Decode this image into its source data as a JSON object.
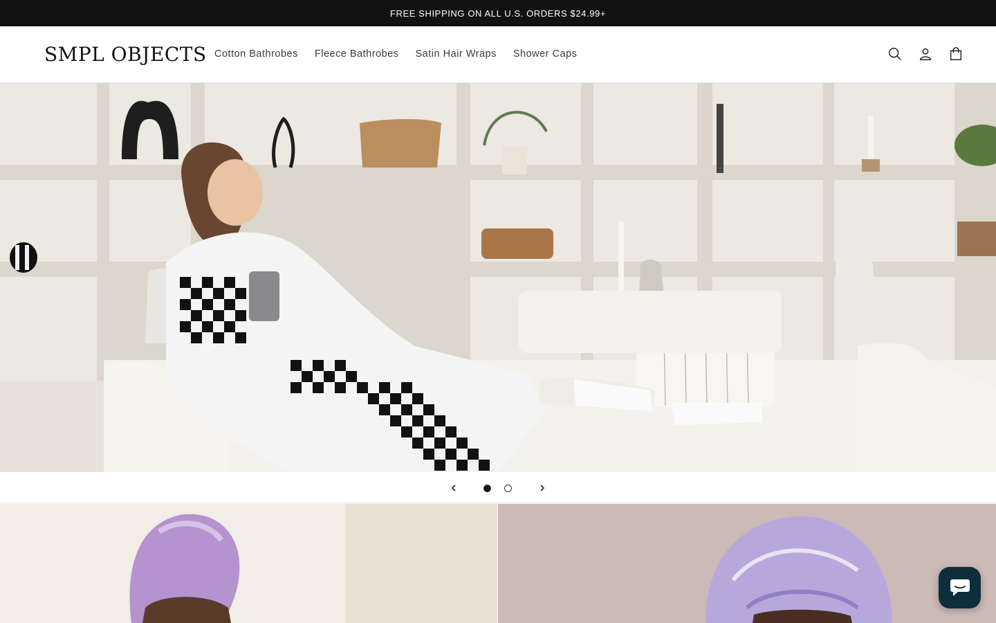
{
  "announcement": {
    "text": "FREE SHIPPING ON ALL U.S. ORDERS $24.99+"
  },
  "header": {
    "logo": "SMPL OBJECTS",
    "nav": [
      "Cotton Bathrobes",
      "Fleece Bathrobes",
      "Satin Hair Wraps",
      "Shower Caps"
    ],
    "icons": [
      "search-icon",
      "account-icon",
      "cart-icon"
    ]
  },
  "hero": {
    "slide_count": 2,
    "active_slide": 1
  },
  "colors": {
    "announcement_bg": "#121212",
    "chat_bg": "#0d2e3d"
  }
}
